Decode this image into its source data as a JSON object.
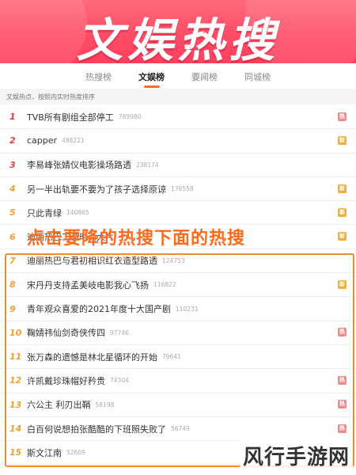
{
  "banner": {
    "title": "文娱热搜"
  },
  "tabs": [
    {
      "label": "热搜榜",
      "active": false
    },
    {
      "label": "文娱榜",
      "active": true
    },
    {
      "label": "要闻榜",
      "active": false
    },
    {
      "label": "同城榜",
      "active": false
    }
  ],
  "subheader": "文娱热点，按照内实时热度排序",
  "items": [
    {
      "rank": "1",
      "title": "TVB所有剧组全部停工",
      "heat": "789980",
      "badge": "热"
    },
    {
      "rank": "2",
      "title": "capper",
      "heat": "488221",
      "badge": "新"
    },
    {
      "rank": "3",
      "title": "李易峰张婧仪电影操场路透",
      "heat": "238174",
      "badge": ""
    },
    {
      "rank": "4",
      "title": "另一半出轨要不要为了孩子选择原谅",
      "heat": "178558",
      "badge": "新"
    },
    {
      "rank": "5",
      "title": "只此青绿",
      "heat": "140865",
      "badge": "新"
    },
    {
      "rank": "6",
      "title": "迪丽热巴工装时尚大片",
      "heat": "",
      "badge": "新"
    },
    {
      "rank": "7",
      "title": "迪丽热巴与君初相识红衣造型路透",
      "heat": "124753",
      "badge": ""
    },
    {
      "rank": "8",
      "title": "宋丹丹支持孟美岐电影我心飞扬",
      "heat": "116822",
      "badge": "新"
    },
    {
      "rank": "9",
      "title": "青年观众喜爱的2021年度十大国产剧",
      "heat": "110231",
      "badge": ""
    },
    {
      "rank": "10",
      "title": "鞠婧祎仙剑奇侠传四",
      "heat": "97746",
      "badge": "热"
    },
    {
      "rank": "11",
      "title": "张万森的遗憾是林北星循环的开始",
      "heat": "79641",
      "badge": ""
    },
    {
      "rank": "12",
      "title": "许凯戴珍珠帽好矜贵",
      "heat": "74304",
      "badge": "热"
    },
    {
      "rank": "13",
      "title": "六公主 利刃出鞘",
      "heat": "58198",
      "badge": "热"
    },
    {
      "rank": "14",
      "title": "白百何说想拍张酷酷的下班照失败了",
      "heat": "56749",
      "badge": "热"
    },
    {
      "rank": "15",
      "title": "斯文江南",
      "heat": "52609",
      "badge": ""
    }
  ],
  "overlay_text": "点击要降的热搜下面的热搜",
  "watermark": "风行手游网",
  "colors": {
    "accent": "#ff6a2c",
    "banner": "#ff4d67",
    "highlight": "#f28c2a",
    "rank_top": "#e04040",
    "rank_other": "#f0a030"
  }
}
